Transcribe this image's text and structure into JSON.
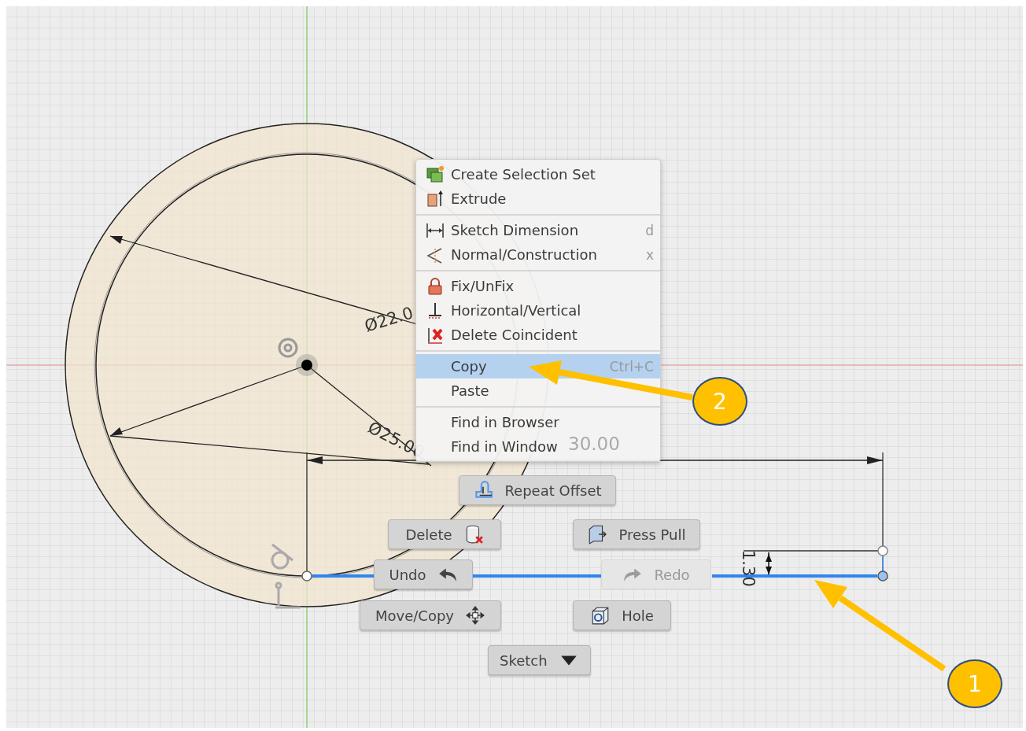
{
  "canvas": {
    "dimension_labels": [
      "Ø22.0",
      "Ø25.00",
      "30.00",
      "1.30"
    ]
  },
  "context_menu": {
    "groups": [
      [
        {
          "label": "Create Selection Set",
          "selected": false
        },
        {
          "label": "Extrude",
          "selected": false
        }
      ],
      [
        {
          "label": "Sketch Dimension",
          "shortcut": "d",
          "selected": false
        },
        {
          "label": "Normal/Construction",
          "shortcut": "x",
          "selected": false
        }
      ],
      [
        {
          "label": "Fix/UnFix",
          "selected": false
        },
        {
          "label": "Horizontal/Vertical",
          "selected": false
        },
        {
          "label": "Delete Coincident",
          "selected": false
        }
      ],
      [
        {
          "label": "Copy",
          "shortcut": "Ctrl+C",
          "selected": true
        },
        {
          "label": "Paste",
          "selected": false
        }
      ],
      [
        {
          "label": "Find in Browser",
          "selected": false
        },
        {
          "label": "Find in Window",
          "selected": false
        }
      ]
    ]
  },
  "marking_menu": {
    "buttons": [
      {
        "label": "Repeat Offset",
        "disabled": false
      },
      {
        "label": "Delete",
        "disabled": false
      },
      {
        "label": "Press Pull",
        "disabled": false
      },
      {
        "label": "Undo",
        "disabled": false
      },
      {
        "label": "Redo",
        "disabled": true
      },
      {
        "label": "Move/Copy",
        "disabled": false
      },
      {
        "label": "Hole",
        "disabled": false
      },
      {
        "label": "Sketch",
        "disabled": false,
        "dropdown": true
      }
    ]
  },
  "callouts": [
    {
      "label": "1"
    },
    {
      "label": "2"
    }
  ]
}
